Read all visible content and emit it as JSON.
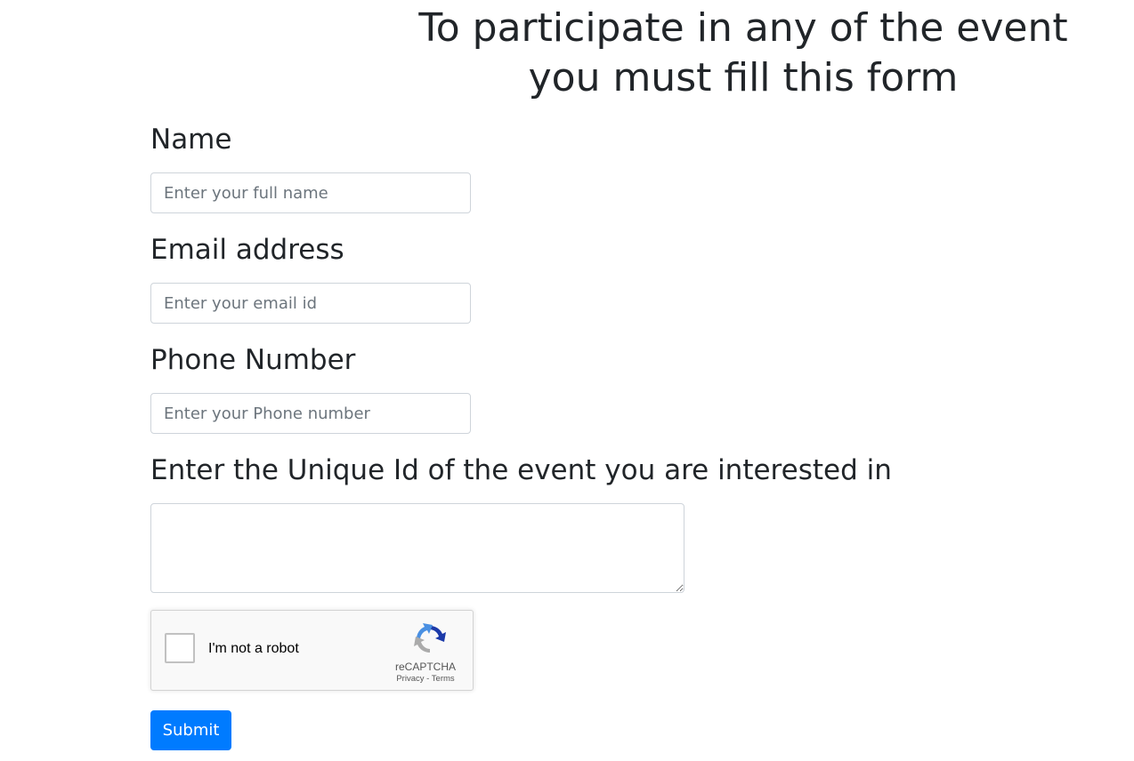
{
  "header": {
    "title_line1": "To participate in any of the event",
    "title_line2": "you must fill this form"
  },
  "form": {
    "name": {
      "label": "Name",
      "placeholder": "Enter your full name",
      "value": ""
    },
    "email": {
      "label": "Email address",
      "placeholder": "Enter your email id",
      "value": ""
    },
    "phone": {
      "label": "Phone Number",
      "placeholder": "Enter your Phone number",
      "value": ""
    },
    "event_id": {
      "label": "Enter the Unique Id of the event you are interested in",
      "value": ""
    },
    "recaptcha": {
      "checkbox_label": "I'm not a robot",
      "brand": "reCAPTCHA",
      "privacy_link": "Privacy",
      "separator": " - ",
      "terms_link": "Terms",
      "icon": "recaptcha-logo-icon",
      "checked": false
    },
    "submit_label": "Submit"
  },
  "colors": {
    "text": "#212529",
    "input_border": "#ced4da",
    "placeholder": "#6c757d",
    "primary": "#007bff",
    "recaptcha_bg": "#f9f9f9",
    "recaptcha_blue": "#1c3aa9",
    "recaptcha_light_blue": "#4a90e2",
    "recaptcha_gray": "#ababab"
  }
}
